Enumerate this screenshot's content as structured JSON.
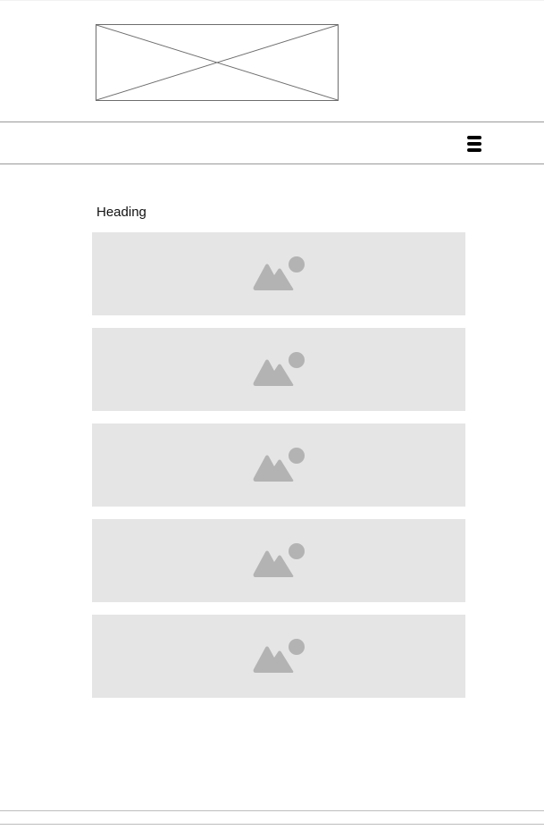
{
  "header": {
    "logo_icon": "image-placeholder-cross-icon",
    "menu_icon": "hamburger-menu-icon"
  },
  "main": {
    "heading": "Heading",
    "images": [
      {
        "icon": "image-icon"
      },
      {
        "icon": "image-icon"
      },
      {
        "icon": "image-icon"
      },
      {
        "icon": "image-icon"
      },
      {
        "icon": "image-icon"
      }
    ]
  },
  "colors": {
    "placeholder_bg": "#e5e5e5",
    "placeholder_icon": "#b3b3b3",
    "border": "#999999"
  }
}
